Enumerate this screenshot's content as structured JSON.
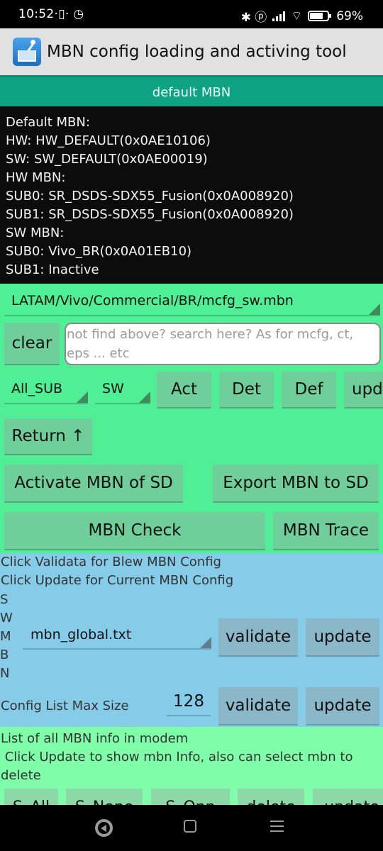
{
  "status_bar": {
    "time": "10:52",
    "time_suffix": "·▯· ◷",
    "icons_text": "✱ ⓟ",
    "battery_percent": "69%"
  },
  "app_bar": {
    "title": "MBN config loading and activing tool",
    "icon": "app-mixer-icon"
  },
  "tab": {
    "label": "default MBN"
  },
  "info": {
    "lines": [
      "Default MBN:",
      "HW: HW_DEFAULT(0x0AE10106)",
      "SW: SW_DEFAULT(0x0AE00019)",
      "HW MBN:",
      "SUB0: SR_DSDS-SDX55_Fusion(0x0A008920)",
      "SUB1: SR_DSDS-SDX55_Fusion(0x0A008920)",
      "SW MBN:",
      "SUB0: Vivo_BR(0x0A01EB10)",
      "SUB1: Inactive"
    ]
  },
  "mbn_selector": {
    "value": "LATAM/Vivo/Commercial/BR/mcfg_sw.mbn"
  },
  "search": {
    "clear_label": "clear",
    "placeholder": "not find above? search here? As for mcfg, ct, eps ... etc"
  },
  "action_row": {
    "sub_spinner": "All_SUB",
    "type_spinner": "SW",
    "buttons": [
      "Act",
      "Det",
      "Def",
      "upd"
    ]
  },
  "return_button": "Return ↑",
  "sd_buttons": {
    "activate": "Activate MBN of SD",
    "export": "Export MBN to SD"
  },
  "check_buttons": {
    "check": "MBN Check",
    "trace": "MBN Trace"
  },
  "sw_mbn_config": {
    "hint1": "Click Validata for Blew MBN Config",
    "hint2": "Click Update for Current MBN Config",
    "vertical_label": [
      "S",
      "W",
      "M",
      "B",
      "N"
    ],
    "file_spinner": "mbn_global.txt",
    "validate_label": "validate",
    "update_label": "update"
  },
  "config_list": {
    "label": "Config List Max Size",
    "value": "128",
    "validate_label": "validate",
    "update_label": "update"
  },
  "modem_list": {
    "title": "List of all MBN info in modem",
    "hint": " Click Update to show mbn Info, also can select mbn to delete",
    "buttons": [
      "S_All",
      "S_None",
      "S_Opp",
      "delete",
      "update"
    ]
  },
  "colors": {
    "tab_bg": "#0fa383",
    "green_panel": "#50ef96",
    "blue_panel": "#86cce9",
    "light_green_panel": "#7ffda9",
    "button_green": "#6fce9a",
    "button_blue": "#8bb8c9"
  }
}
